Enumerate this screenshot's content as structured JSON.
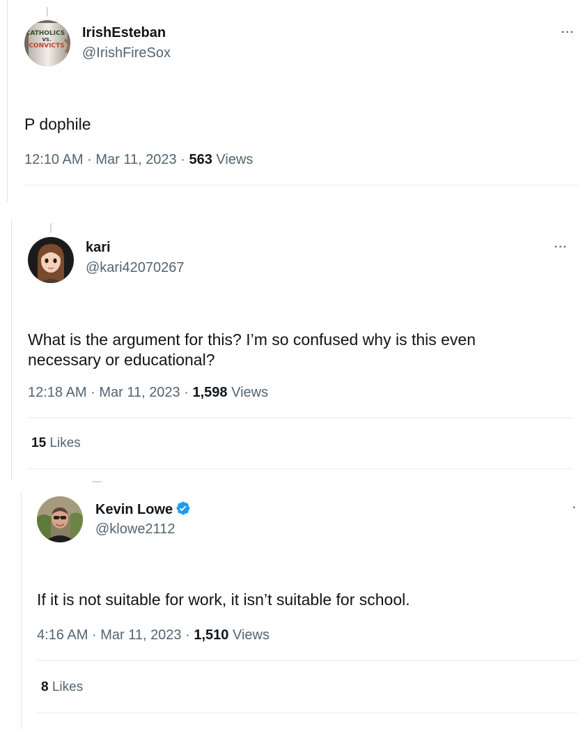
{
  "tweets": [
    {
      "display_name": "IrishEsteban",
      "handle": "@IrishFireSox",
      "avatar_text": {
        "line1": "CATHOLICS",
        "line2": "VS.",
        "line3": "CONVICTS"
      },
      "text": "P  dophile",
      "time": "12:10 AM",
      "sep1": "·",
      "date": "Mar 11, 2023",
      "sep2": "·",
      "views_count": "563",
      "views_label": "Views",
      "more": "···"
    },
    {
      "display_name": "kari",
      "handle": "@kari42070267",
      "text": "What is the argument for this? I’m so confused why is this even necessary or educational?",
      "time": "12:18 AM",
      "sep1": "·",
      "date": "Mar 11, 2023",
      "sep2": "·",
      "views_count": "1,598",
      "views_label": "Views",
      "likes_count": "15",
      "likes_label": "Likes",
      "more": "···"
    },
    {
      "display_name": "Kevin Lowe",
      "handle": "@klowe2112",
      "verified": true,
      "text": "If it is not suitable for work, it isn’t suitable for school.",
      "time": "4:16 AM",
      "sep1": "·",
      "date": "Mar 11, 2023",
      "sep2": "·",
      "views_count": "1,510",
      "views_label": "Views",
      "likes_count": "8",
      "likes_label": "Likes",
      "more": "·"
    }
  ],
  "colors": {
    "text_primary": "#0f1419",
    "text_secondary": "#536471",
    "divider": "#e6ecf0",
    "verified_blue": "#1d9bf0"
  }
}
